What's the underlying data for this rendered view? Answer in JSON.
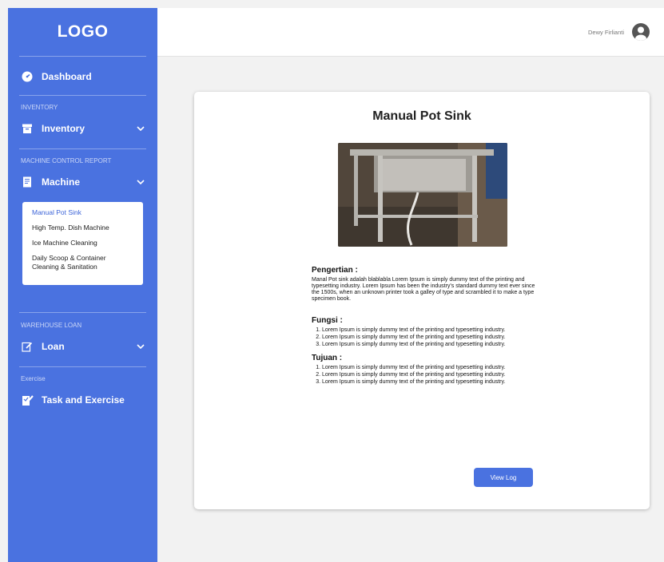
{
  "sidebar": {
    "logo": "LOGO",
    "dashboard_label": "Dashboard",
    "section_inventory": "INVENTORY",
    "inventory_label": "Inventory",
    "section_machine": "MACHINE CONTROL REPORT",
    "machine_label": "Machine",
    "machine_submenu": [
      "Manual Pot Sink",
      "High Temp. Dish Machine",
      "Ice Machine Cleaning",
      "Daily Scoop & Container Cleaning & Sanitation"
    ],
    "section_warehouse": "WAREHOUSE LOAN",
    "loan_label": "Loan",
    "section_exercise": "Exercise",
    "task_label": "Task and Exercise"
  },
  "header": {
    "username": "Dewy Firlianti"
  },
  "main": {
    "title": "Manual Pot Sink",
    "pengertian_heading": "Pengertian :",
    "pengertian_text": "Manal Pot sink adalah blablabla  Lorem Ipsum is simply dummy text of the printing and typesetting industry. Lorem Ipsum has been the industry's standard dummy text ever since the 1500s, when an unknown printer took a galley of type and scrambled it to make a type specimen book.",
    "fungsi_heading": "Fungsi :",
    "fungsi_items": [
      "Lorem Ipsum is simply dummy text of the printing and typesetting industry.",
      "Lorem Ipsum is simply dummy text of the printing and typesetting industry.",
      "Lorem Ipsum is simply dummy text of the printing and typesetting industry."
    ],
    "tujuan_heading": "Tujuan :",
    "tujuan_items": [
      "Lorem Ipsum is simply dummy text of the printing and typesetting industry.",
      "Lorem Ipsum is simply dummy text of the printing and typesetting industry.",
      "Lorem Ipsum is simply dummy text of the printing and typesetting industry."
    ],
    "view_log_label": "View Log"
  },
  "colors": {
    "sidebar": "#4a72e0",
    "accent": "#3b63d8",
    "background": "#f2f2f2"
  }
}
